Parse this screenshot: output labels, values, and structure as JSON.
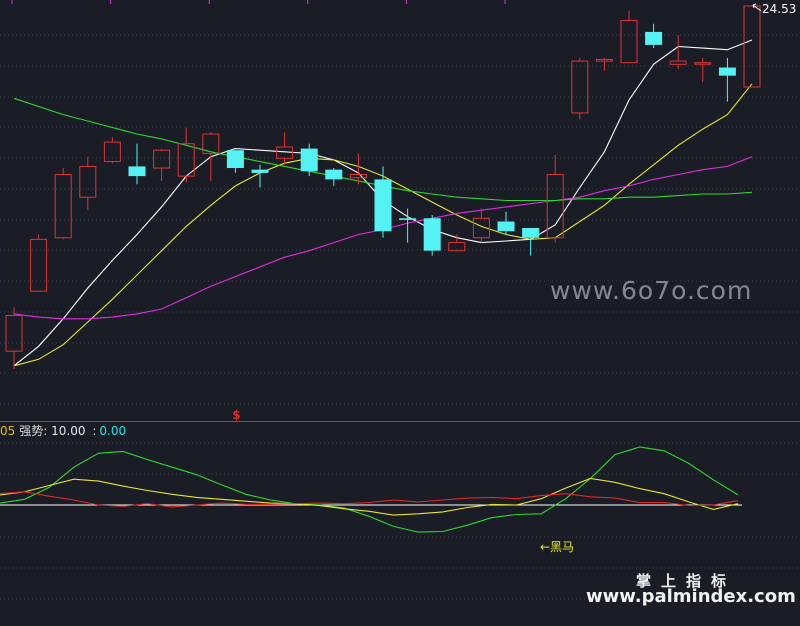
{
  "legend": {
    "prefix": "05",
    "name": "强势:",
    "value1": "10.00",
    "separator": ":",
    "value2": "0.00"
  },
  "price_label": "24.53",
  "marker_signal": "$",
  "annotation": "←黑马",
  "watermark": "www.6o7o.com",
  "brand": {
    "cn": "掌上指标",
    "url": "www.palmindex.com"
  },
  "colors": {
    "background": "#1a1d26",
    "up_candle": "#e03434",
    "down_candle": "#54f2f2",
    "ma_white": "#ffffff",
    "ma_yellow": "#e6e62e",
    "ma_magenta": "#e02ee0",
    "ma_green": "#2ed82e",
    "osc_green": "#2ed82e",
    "osc_yellow": "#e6e62e",
    "osc_red": "#e02828",
    "ref_line": "#ffffff"
  },
  "chart_data": [
    {
      "type": "candlestick",
      "price_axis_labels": [
        "24.53"
      ],
      "series": [
        {
          "name": "",
          "kind": "ohlc",
          "values": [
            [
              13.85,
              15.2,
              13.3,
              14.95
            ],
            [
              15.7,
              17.45,
              15.7,
              17.3
            ],
            [
              17.35,
              19.5,
              17.3,
              19.3
            ],
            [
              18.6,
              19.85,
              18.2,
              19.55
            ],
            [
              19.7,
              20.45,
              19.65,
              20.3
            ],
            [
              19.55,
              20.25,
              19.0,
              19.25
            ],
            [
              19.5,
              20.1,
              19.1,
              20.05
            ],
            [
              19.25,
              20.75,
              19.05,
              20.25
            ],
            [
              19.95,
              20.6,
              19.1,
              20.55
            ],
            [
              20.05,
              20.05,
              19.35,
              19.5
            ],
            [
              19.45,
              19.6,
              18.9,
              19.35
            ],
            [
              19.8,
              20.6,
              19.6,
              20.15
            ],
            [
              20.1,
              20.25,
              19.25,
              19.4
            ],
            [
              19.45,
              19.5,
              18.95,
              19.15
            ],
            [
              19.2,
              19.95,
              19.0,
              19.3
            ],
            [
              19.15,
              19.55,
              17.35,
              17.55
            ],
            [
              17.95,
              18.25,
              17.2,
              17.9
            ],
            [
              17.95,
              18.05,
              16.8,
              16.95
            ],
            [
              16.95,
              17.45,
              16.95,
              17.2
            ],
            [
              17.35,
              18.25,
              17.2,
              17.95
            ],
            [
              17.85,
              18.15,
              17.45,
              17.55
            ],
            [
              17.65,
              17.65,
              16.8,
              17.35
            ],
            [
              17.35,
              19.9,
              17.2,
              19.3
            ],
            [
              21.2,
              22.9,
              21.0,
              22.8
            ],
            [
              22.8,
              22.9,
              22.5,
              22.85
            ],
            [
              22.75,
              24.35,
              22.75,
              24.05
            ],
            [
              23.7,
              23.95,
              23.2,
              23.3
            ],
            [
              22.7,
              23.6,
              22.55,
              22.8
            ],
            [
              22.75,
              22.9,
              22.15,
              22.75
            ],
            [
              22.6,
              22.9,
              21.55,
              22.35
            ],
            [
              22.0,
              24.53,
              22.0,
              24.5
            ]
          ]
        },
        {
          "name": "",
          "kind": "line",
          "color": "#ffffff",
          "start": 0,
          "values": [
            13.4,
            14.0,
            14.85,
            15.8,
            16.65,
            17.45,
            18.3,
            19.25,
            19.85,
            20.1,
            20.05,
            20.0,
            19.95,
            19.75,
            19.35,
            18.5,
            18.0,
            17.6,
            17.35,
            17.2,
            17.25,
            17.3,
            17.75,
            18.9,
            20.0,
            21.6,
            22.7,
            23.25,
            23.2,
            23.15,
            23.45
          ]
        },
        {
          "name": "",
          "kind": "line",
          "color": "#e6e62e",
          "start": 0,
          "values": [
            13.4,
            13.6,
            14.05,
            14.75,
            15.45,
            16.2,
            16.95,
            17.7,
            18.35,
            18.95,
            19.35,
            19.65,
            19.8,
            19.75,
            19.55,
            19.25,
            18.85,
            18.45,
            18.05,
            17.7,
            17.45,
            17.3,
            17.35,
            17.85,
            18.35,
            19.0,
            19.6,
            20.2,
            20.7,
            21.15,
            22.1
          ]
        },
        {
          "name": "",
          "kind": "line",
          "color": "#e02ee0",
          "start": 0,
          "values": [
            15.0,
            14.9,
            14.85,
            14.85,
            14.9,
            15.0,
            15.15,
            15.5,
            15.85,
            16.15,
            16.45,
            16.75,
            16.95,
            17.2,
            17.45,
            17.6,
            17.8,
            17.95,
            18.1,
            18.2,
            18.3,
            18.4,
            18.5,
            18.6,
            18.8,
            18.95,
            19.15,
            19.3,
            19.45,
            19.55,
            19.85
          ]
        },
        {
          "name": "",
          "kind": "line",
          "color": "#2ed82e",
          "start": 0,
          "values": [
            21.65,
            21.4,
            21.15,
            20.95,
            20.75,
            20.55,
            20.4,
            20.2,
            20.0,
            19.85,
            19.7,
            19.55,
            19.4,
            19.25,
            19.1,
            18.95,
            18.8,
            18.7,
            18.6,
            18.55,
            18.5,
            18.5,
            18.5,
            18.55,
            18.55,
            18.6,
            18.6,
            18.65,
            18.7,
            18.7,
            18.75
          ]
        }
      ]
    },
    {
      "type": "line",
      "series": [
        {
          "name": "",
          "color": "#2ed82e",
          "values": [
            3,
            9,
            28,
            60,
            82,
            85,
            72,
            60,
            48,
            32,
            17,
            8,
            2,
            0,
            -5,
            -18,
            -34,
            -43,
            -42,
            -32,
            -20,
            -15,
            -14,
            10,
            42,
            80,
            92,
            86,
            66,
            40,
            16
          ]
        },
        {
          "name": "",
          "color": "#e6e62e",
          "values": [
            16,
            21,
            31,
            41,
            38,
            30,
            23,
            17,
            12,
            9,
            6,
            3,
            2,
            -1,
            -6,
            -10,
            -16,
            -14,
            -11,
            -4,
            1,
            0,
            10,
            27,
            42,
            36,
            26,
            18,
            5,
            -7,
            2
          ]
        },
        {
          "name": "",
          "color": "#e02828",
          "values": [
            18,
            21,
            14,
            8,
            0,
            -2,
            2,
            -3,
            0,
            3,
            1,
            1,
            2,
            3,
            2,
            4,
            8,
            5,
            8,
            11,
            12,
            10,
            15,
            18,
            13,
            11,
            4,
            4,
            -1,
            0,
            7
          ]
        },
        {
          "name": "",
          "color": "#ffffff",
          "kind": "reference",
          "values": [
            0
          ]
        }
      ]
    }
  ]
}
